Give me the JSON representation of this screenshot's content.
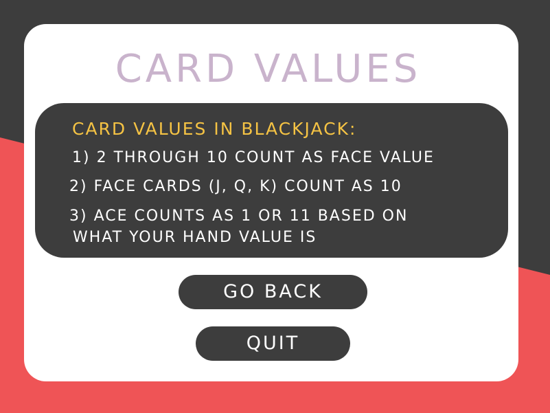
{
  "colors": {
    "background_dark": "#3d3d3d",
    "background_red": "#ef5456",
    "card": "#ffffff",
    "title": "#c9b3cc",
    "heading": "#f5c344",
    "text": "#ffffff"
  },
  "screen": {
    "title": "CARD VALUES"
  },
  "info": {
    "heading": "CARD VALUES IN BLACKJACK:",
    "rules": [
      "1) 2 THROUGH 10 COUNT AS FACE VALUE",
      "2) FACE CARDS (J, Q, K) COUNT AS 10",
      "3) ACE COUNTS AS 1 OR 11 BASED ON",
      "WHAT YOUR HAND VALUE IS"
    ]
  },
  "buttons": {
    "go_back": "GO BACK",
    "quit": "QUIT"
  }
}
